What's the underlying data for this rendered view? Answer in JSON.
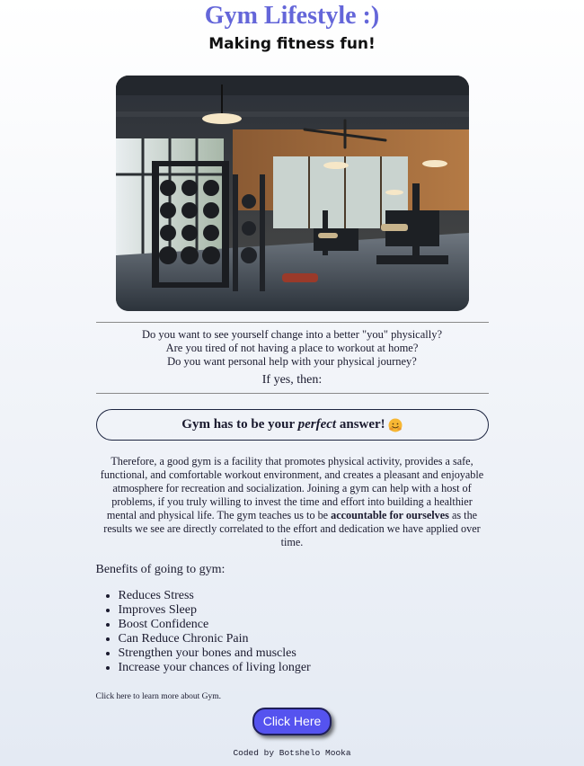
{
  "header": {
    "title": "Gym Lifestyle :)",
    "subtitle": "Making fitness fun!"
  },
  "hero": {
    "icon": "gym-interior-photo"
  },
  "intro": {
    "questions": [
      "Do you want to see yourself change into a better \"you\" physically?",
      "Are you tired of not having a place to workout at home?",
      "Do you want personal help with your physical journey?"
    ],
    "if_yes": "If yes, then:"
  },
  "callout": {
    "prefix": "Gym has to be your ",
    "emphasis": "perfect",
    "suffix": " answer!",
    "emoji": "hugging-face-emoji"
  },
  "body": {
    "paragraph_start": "Therefore, a good gym is a facility that promotes physical activity, provides a safe, functional, and comfortable workout environment, and creates a pleasant and enjoyable atmosphere for recreation and socialization. Joining a gym can help with a host of problems, if you truly willing to invest the time and effort into building a healthier mental and physical life. The gym teaches us to be ",
    "paragraph_bold": "accountable for ourselves",
    "paragraph_end": " as the results we see are directly correlated to the effort and dedication we have applied over time."
  },
  "benefits": {
    "heading": "Benefits of going to gym:",
    "items": [
      "Reduces Stress",
      "Improves Sleep",
      "Boost Confidence",
      "Can Reduce Chronic Pain",
      "Strengthen your bones and muscles",
      "Increase your chances of living longer"
    ]
  },
  "cta": {
    "learn_text": "Click here to learn more about Gym.",
    "button_label": "Click Here",
    "button_color": "#5553ef"
  },
  "footer": {
    "credit": "Coded by Botshelo Mooka"
  },
  "colors": {
    "title": "#6466d9"
  }
}
